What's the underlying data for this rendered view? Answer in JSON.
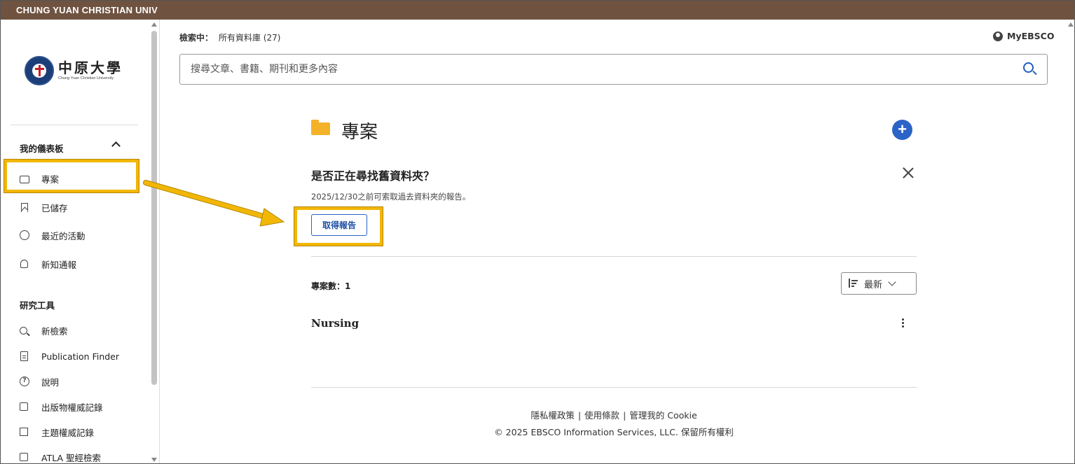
{
  "topbar": {
    "institution": "CHUNG YUAN CHRISTIAN UNIV"
  },
  "logo": {
    "name_cn": "中原大學",
    "name_en": "Chung Yuan Christian University"
  },
  "sidebar": {
    "dashboard_heading": "我的儀表板",
    "dashboard_items": [
      {
        "label": "專案",
        "icon": "folder-icon"
      },
      {
        "label": "已儲存",
        "icon": "bookmark-icon"
      },
      {
        "label": "最近的活動",
        "icon": "history-icon"
      },
      {
        "label": "新知通報",
        "icon": "bell-icon"
      }
    ],
    "tools_heading": "研究工具",
    "tools_items": [
      {
        "label": "新檢索",
        "icon": "search-icon"
      },
      {
        "label": "Publication Finder",
        "icon": "document-icon"
      },
      {
        "label": "說明",
        "icon": "help-icon"
      },
      {
        "label": "出版物權威記錄",
        "icon": "publication-authority-icon"
      },
      {
        "label": "主題權威記錄",
        "icon": "subject-tree-icon"
      },
      {
        "label": "ATLA 聖經檢索",
        "icon": "scripture-icon"
      }
    ]
  },
  "header": {
    "searching_label": "檢索中：",
    "searching_value": "所有資料庫 (27)",
    "myebsco_label": "MyEBSCO"
  },
  "search": {
    "placeholder": "搜尋文章、書籍、期刊和更多內容"
  },
  "projects": {
    "title": "專案",
    "notice_title": "是否正在尋找舊資料夾？",
    "notice_desc": "2025/12/30之前可索取過去資料夾的報告。",
    "get_report_label": "取得報告",
    "count_label": "專案數：1",
    "sort_label": "最新",
    "items": [
      {
        "name": "Nursing"
      }
    ]
  },
  "footer": {
    "privacy": "隱私權政策",
    "terms": "使用條款",
    "cookie": "管理我的 Cookie",
    "separator": "|",
    "copyright": "© 2025 EBSCO Information Services, LLC. 保留所有權利"
  },
  "colors": {
    "topbar": "#6f5340",
    "accent_blue": "#2b63c6",
    "folder_yellow": "#f3b228",
    "highlight_yellow": "#f2b705"
  }
}
